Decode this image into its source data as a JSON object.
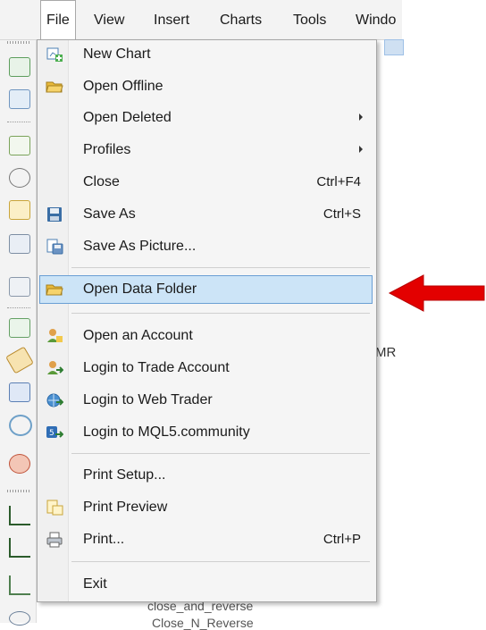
{
  "menubar": {
    "items": [
      {
        "label": "File",
        "active": true
      },
      {
        "label": "View"
      },
      {
        "label": "Insert"
      },
      {
        "label": "Charts"
      },
      {
        "label": "Tools"
      },
      {
        "label": "Windo"
      }
    ]
  },
  "file_menu": {
    "items": [
      {
        "label": "New Chart",
        "icon": "new-chart-icon"
      },
      {
        "label": "Open Offline",
        "icon": "open-folder-icon"
      },
      {
        "label": "Open Deleted",
        "submenu": true
      },
      {
        "label": "Profiles",
        "submenu": true
      },
      {
        "label": "Close",
        "shortcut": "Ctrl+F4"
      },
      {
        "label": "Save As",
        "shortcut": "Ctrl+S",
        "icon": "floppy-disk-icon"
      },
      {
        "label": "Save As Picture...",
        "icon": "save-picture-icon"
      },
      {
        "label": "Open Data Folder",
        "icon": "folder-icon",
        "highlighted": true
      },
      {
        "label": "Open an Account",
        "icon": "user-add-icon"
      },
      {
        "label": "Login to Trade Account",
        "icon": "user-login-icon"
      },
      {
        "label": "Login to Web Trader",
        "icon": "web-trader-icon"
      },
      {
        "label": "Login to MQL5.community",
        "icon": "mql5-icon"
      },
      {
        "label": "Print Setup..."
      },
      {
        "label": "Print Preview",
        "icon": "print-preview-icon"
      },
      {
        "label": "Print...",
        "shortcut": "Ctrl+P",
        "icon": "printer-icon"
      },
      {
        "label": "Exit"
      }
    ]
  },
  "background": {
    "right_text": "MR",
    "bottom_text_1": "close_and_reverse",
    "bottom_text_2": "Close_N_Reverse"
  },
  "colors": {
    "highlight_bg": "#cce4f7",
    "highlight_border": "#6a9fd4",
    "arrow": "#e30000"
  }
}
